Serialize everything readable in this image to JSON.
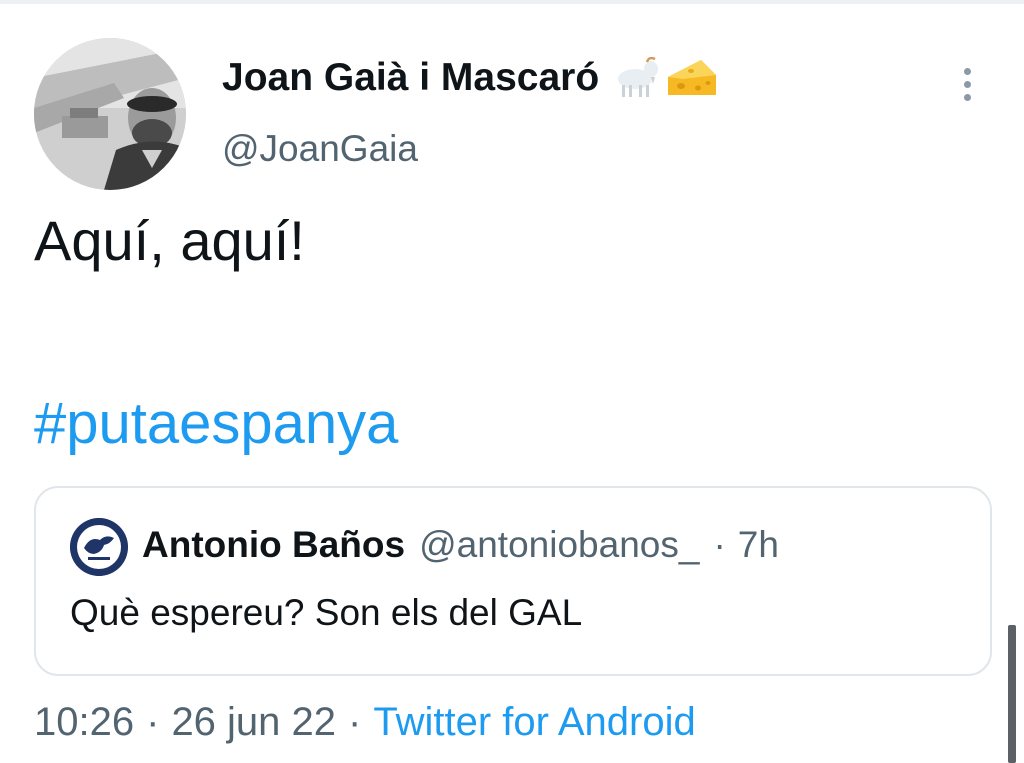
{
  "tweet": {
    "author": {
      "display_name": "Joan Gaià i Mascaró",
      "emoji_1": "🐐",
      "emoji_2": "🧀",
      "handle": "@JoanGaia"
    },
    "text": "Aquí, aquí!",
    "hashtag": "#putaespanya",
    "quoted": {
      "display_name": "Antonio Baños",
      "handle": "@antoniobanos_",
      "separator": "·",
      "time": "7h",
      "text": "Què espereu? Son els del GAL"
    },
    "meta": {
      "time": "10:26",
      "separator": "·",
      "date": "26 jun 22",
      "source": "Twitter for Android"
    }
  },
  "icons": {
    "more": "more-vertical-icon",
    "goat": "goat-emoji",
    "cheese": "cheese-emoji"
  },
  "colors": {
    "link": "#1d9bf0",
    "secondary_text": "#536471",
    "primary_text": "#0f1419",
    "border": "#e1e6ea"
  }
}
